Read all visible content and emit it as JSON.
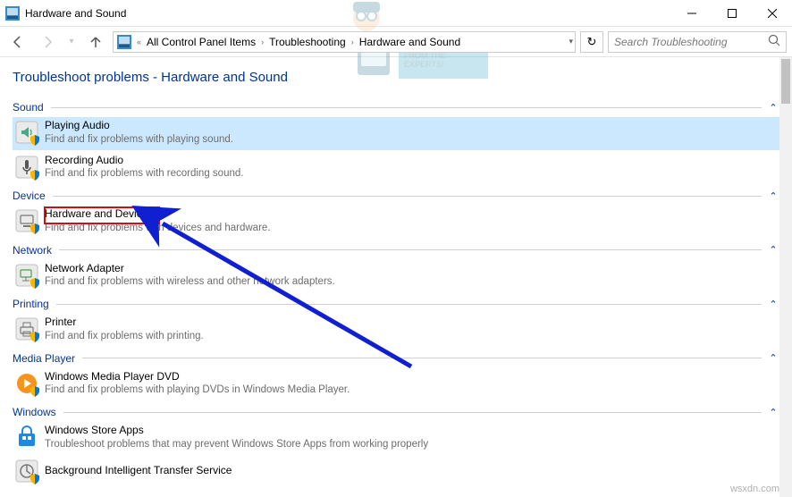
{
  "titlebar": {
    "title": "Hardware and Sound"
  },
  "breadcrumb": {
    "items": [
      "All Control Panel Items",
      "Troubleshooting",
      "Hardware and Sound"
    ]
  },
  "search": {
    "placeholder": "Search Troubleshooting"
  },
  "heading": "Troubleshoot problems - Hardware and Sound",
  "sections": [
    {
      "title": "Sound",
      "items": [
        {
          "title": "Playing Audio",
          "desc": "Find and fix problems with playing sound.",
          "selected": true,
          "icon": "speaker"
        },
        {
          "title": "Recording Audio",
          "desc": "Find and fix problems with recording sound.",
          "icon": "mic"
        }
      ]
    },
    {
      "title": "Device",
      "items": [
        {
          "title": "Hardware and Devices",
          "desc": "Find and fix problems with devices and hardware.",
          "highlighted": true,
          "icon": "device"
        }
      ]
    },
    {
      "title": "Network",
      "items": [
        {
          "title": "Network Adapter",
          "desc": "Find and fix problems with wireless and other network adapters.",
          "icon": "network"
        }
      ]
    },
    {
      "title": "Printing",
      "items": [
        {
          "title": "Printer",
          "desc": "Find and fix problems with printing.",
          "icon": "printer"
        }
      ]
    },
    {
      "title": "Media Player",
      "items": [
        {
          "title": "Windows Media Player DVD",
          "desc": "Find and fix problems with playing DVDs in Windows Media Player.",
          "icon": "wmp"
        }
      ]
    },
    {
      "title": "Windows",
      "items": [
        {
          "title": "Windows Store Apps",
          "desc": "Troubleshoot problems that may prevent Windows Store Apps from working properly",
          "icon": "store"
        },
        {
          "title": "Background Intelligent Transfer Service",
          "desc": "",
          "icon": "bits"
        }
      ]
    }
  ],
  "watermark_text": "TECH HOW-TO'S FROM THE EXPERTS!",
  "footer": "wsxdn.com"
}
